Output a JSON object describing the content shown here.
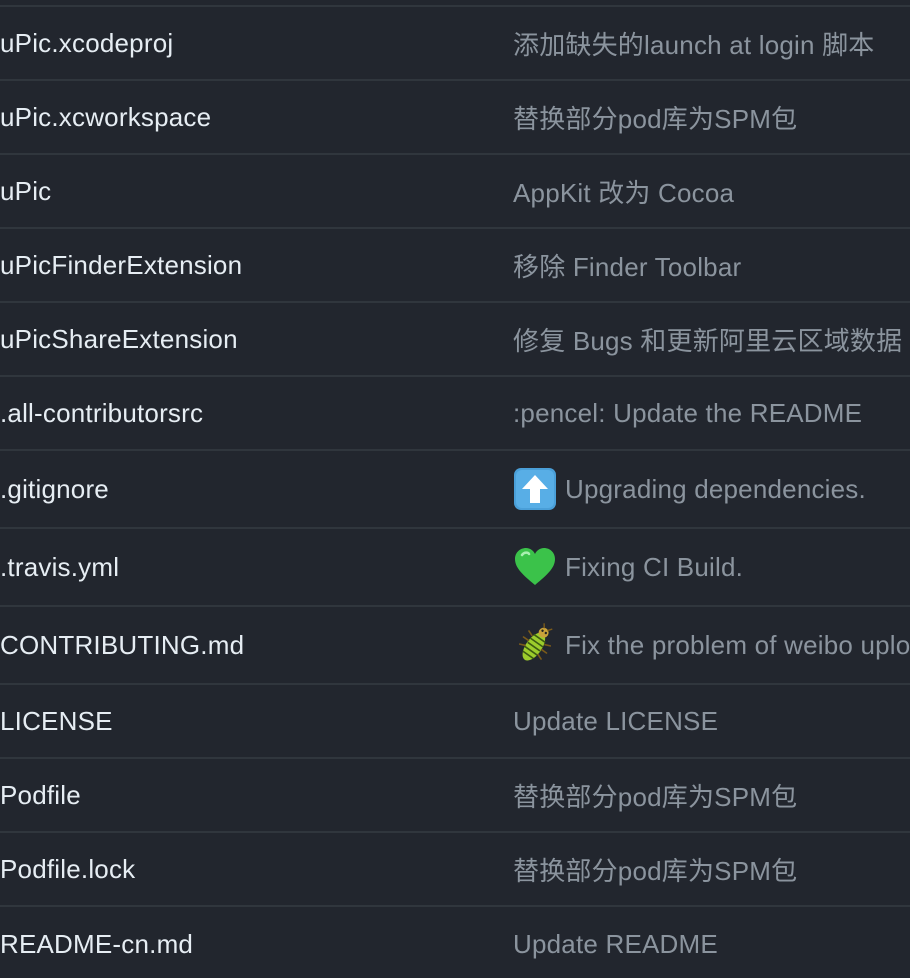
{
  "file_list": {
    "rows": [
      {
        "name": "uPic.xcodeproj",
        "commit": "添加缺失的launch at login 脚本",
        "emoji": ""
      },
      {
        "name": "uPic.xcworkspace",
        "commit": "替换部分pod库为SPM包",
        "emoji": ""
      },
      {
        "name": "uPic",
        "commit": "AppKit 改为 Cocoa",
        "emoji": ""
      },
      {
        "name": "uPicFinderExtension",
        "commit": "移除 Finder Toolbar",
        "emoji": ""
      },
      {
        "name": "uPicShareExtension",
        "commit": "修复 Bugs 和更新阿里云区域数据",
        "emoji": ""
      },
      {
        "name": ".all-contributorsrc",
        "commit": ":pencel: Update the README",
        "emoji": ""
      },
      {
        "name": ".gitignore",
        "commit": "Upgrading dependencies.",
        "emoji": "arrow-up-icon"
      },
      {
        "name": ".travis.yml",
        "commit": "Fixing CI Build.",
        "emoji": "green-heart-icon"
      },
      {
        "name": "CONTRIBUTING.md",
        "commit": "Fix the problem of weibo upload",
        "emoji": "bug-icon"
      },
      {
        "name": "LICENSE",
        "commit": "Update LICENSE",
        "emoji": ""
      },
      {
        "name": "Podfile",
        "commit": "替换部分pod库为SPM包",
        "emoji": ""
      },
      {
        "name": "Podfile.lock",
        "commit": "替换部分pod库为SPM包",
        "emoji": ""
      },
      {
        "name": "README-cn.md",
        "commit": "Update README",
        "emoji": ""
      }
    ]
  },
  "colors": {
    "background": "#22262e",
    "file_name": "#e6edf3",
    "commit_message": "#8b949e",
    "row_border": "#30363d"
  }
}
